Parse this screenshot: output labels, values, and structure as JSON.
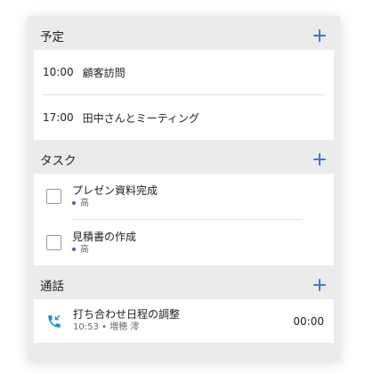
{
  "schedule": {
    "title": "予定",
    "items": [
      {
        "time": "10:00",
        "label": "顧客訪問"
      },
      {
        "time": "17:00",
        "label": "田中さんとミーティング"
      }
    ]
  },
  "tasks": {
    "title": "タスク",
    "items": [
      {
        "label": "プレゼン資料完成",
        "priority": "高"
      },
      {
        "label": "見積書の作成",
        "priority": "高"
      }
    ]
  },
  "calls": {
    "title": "通話",
    "items": [
      {
        "label": "打ち合わせ日程の調整",
        "time": "10:53",
        "person": "増穂 澪",
        "duration": "00:00"
      }
    ]
  },
  "colors": {
    "accent": "#3a78d6",
    "priority_dot": "#8a3fb8",
    "call_icon": "#1a8fd6"
  },
  "icons": {
    "add": "plus-icon",
    "call": "incoming-call-icon"
  }
}
